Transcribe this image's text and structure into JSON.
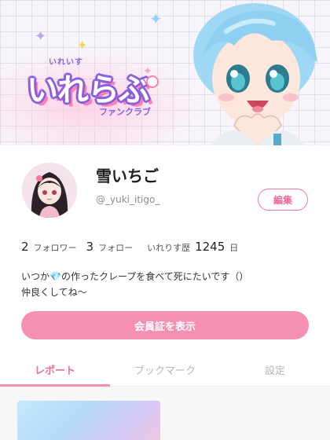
{
  "banner": {
    "logo_sub": "いれいす",
    "logo_main": "いれらぶ",
    "logo_fan": "ファンクラブ"
  },
  "profile": {
    "name": "雪いちご",
    "handle": "@_yuki_itigo_",
    "edit_label": "編集"
  },
  "stats": {
    "followers_count": "2",
    "followers_label": "フォロワー",
    "following_count": "3",
    "following_label": "フォロー",
    "history_label": "いれりす歴",
    "history_count": "1245",
    "history_unit": "日"
  },
  "bio": {
    "line1": "いつか💎の作ったクレープを食べて死にたいです（）",
    "line2": "仲良くしてね〜"
  },
  "member_button": "会員証を表示",
  "tabs": [
    {
      "label": "レポート",
      "active": true
    },
    {
      "label": "ブックマーク",
      "active": false
    },
    {
      "label": "設定",
      "active": false
    }
  ],
  "colors": {
    "accent": "#f58fb3",
    "accent_text": "#f06b9d",
    "logo_purple": "#8b5ee0"
  }
}
